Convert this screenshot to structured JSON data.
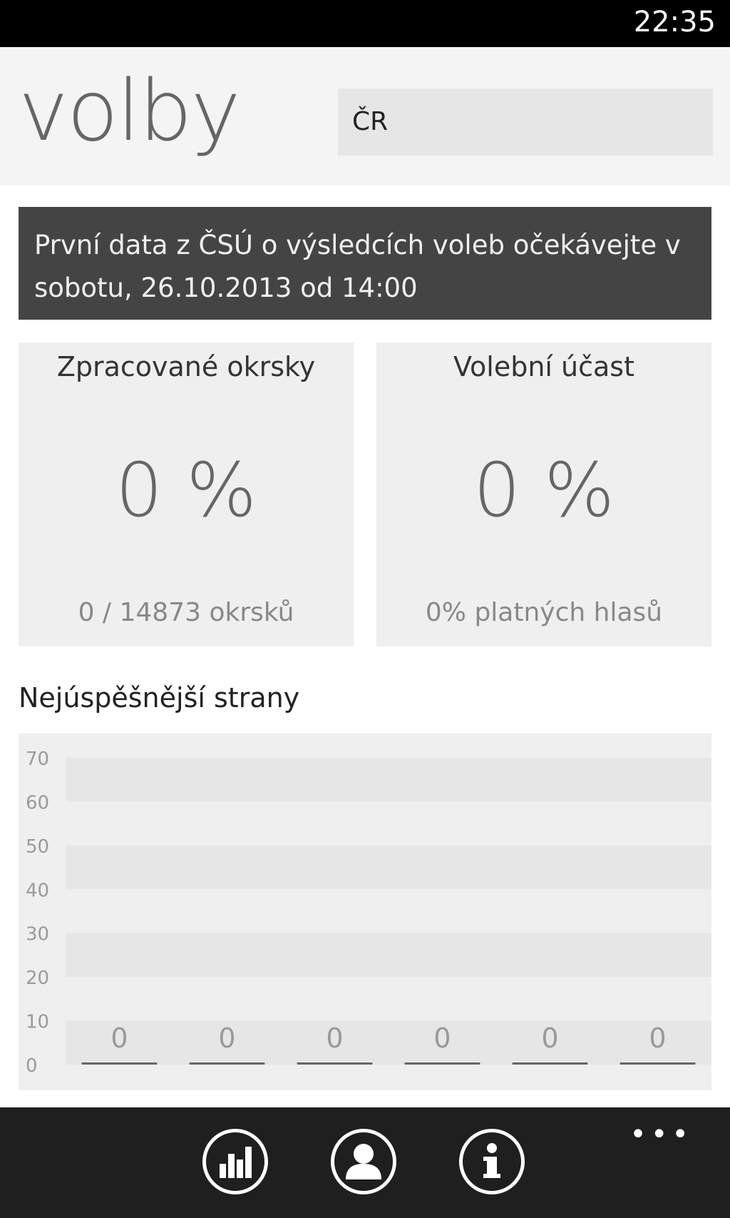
{
  "status": {
    "time": "22:35"
  },
  "header": {
    "title": "volby",
    "region": "ČR"
  },
  "notice": {
    "text": "První data z ČSÚ o výsledcích voleb očekávejte v sobotu, 26.10.2013 od 14:00"
  },
  "cards": [
    {
      "title": "Zpracované okrsky",
      "value": "0 %",
      "sub": "0 / 14873 okrsků"
    },
    {
      "title": "Volební účast",
      "value": "0 %",
      "sub": "0% platných hlasů"
    }
  ],
  "section": {
    "title": "Nejúspěšnější strany"
  },
  "chart_data": {
    "type": "bar",
    "title": "",
    "xlabel": "",
    "ylabel": "",
    "ylim": [
      0,
      70
    ],
    "yticks": [
      0,
      10,
      20,
      30,
      40,
      50,
      60,
      70
    ],
    "categories": [
      "",
      "",
      "",
      "",
      "",
      ""
    ],
    "values": [
      0,
      0,
      0,
      0,
      0,
      0
    ],
    "data_labels": [
      "0",
      "0",
      "0",
      "0",
      "0",
      "0"
    ],
    "grid": true,
    "bar_color": "#666666",
    "band_color": "#e6e6e6"
  },
  "appbar": {
    "more": "•••",
    "buttons": [
      {
        "icon": "bar-chart-icon"
      },
      {
        "icon": "person-icon"
      },
      {
        "icon": "info-icon"
      }
    ]
  },
  "colors": {
    "status_bar": "#000000",
    "header_bg": "#f4f4f4",
    "notice_bg": "#444444",
    "card_bg": "#efefef",
    "app_bar": "#1f1f1f"
  }
}
